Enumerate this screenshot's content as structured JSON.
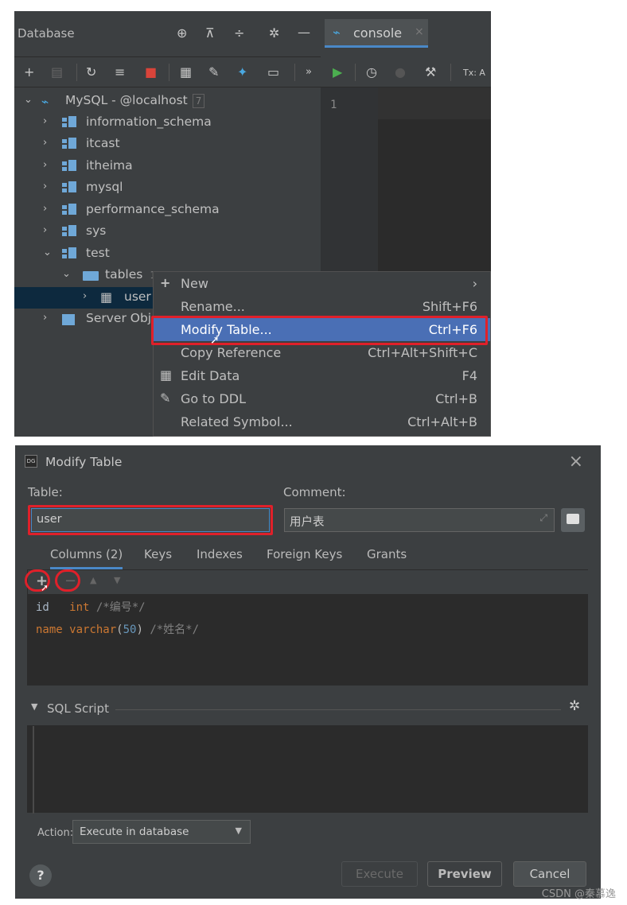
{
  "top": {
    "panel_title": "Database",
    "tab_label": "console",
    "tx_label": "Tx: A",
    "line_number": "1",
    "tree": [
      {
        "label": "MySQL - @localhost",
        "badge": "7",
        "level": "root"
      },
      {
        "label": "information_schema"
      },
      {
        "label": "itcast"
      },
      {
        "label": "itheima"
      },
      {
        "label": "mysql"
      },
      {
        "label": "performance_schema"
      },
      {
        "label": "sys"
      },
      {
        "label": "test"
      },
      {
        "label": "tables",
        "badge": "1"
      },
      {
        "label": "user"
      },
      {
        "label": "Server Obj"
      }
    ],
    "menu": [
      {
        "label": "New",
        "shortcut": "›"
      },
      {
        "label": "Rename...",
        "shortcut": "Shift+F6"
      },
      {
        "label": "Modify Table...",
        "shortcut": "Ctrl+F6"
      },
      {
        "label": "Copy Reference",
        "shortcut": "Ctrl+Alt+Shift+C"
      },
      {
        "label": "Edit Data",
        "shortcut": "F4"
      },
      {
        "label": "Go to DDL",
        "shortcut": "Ctrl+B"
      },
      {
        "label": "Related Symbol...",
        "shortcut": "Ctrl+Alt+B"
      }
    ]
  },
  "dialog": {
    "title": "Modify Table",
    "table_label": "Table:",
    "table_value": "user",
    "comment_label": "Comment:",
    "comment_value": "用户表",
    "tabs": [
      "Columns (2)",
      "Keys",
      "Indexes",
      "Foreign Keys",
      "Grants"
    ],
    "columns": [
      {
        "name": "id",
        "type": "int",
        "comment": "/*编号*/"
      },
      {
        "name": "name",
        "type": "varchar",
        "size": "50",
        "comment": "/*姓名*/"
      }
    ],
    "sql_section": "SQL Script",
    "action_label": "Action:",
    "action_value": "Execute in database",
    "buttons": {
      "execute": "Execute",
      "preview": "Preview",
      "cancel": "Cancel"
    },
    "help": "?"
  },
  "watermark": "CSDN @秦慕逸",
  "colors": {
    "highlight": "#4a6fb5",
    "annotation_red": "#e0202a",
    "accent": "#4a88c7"
  }
}
